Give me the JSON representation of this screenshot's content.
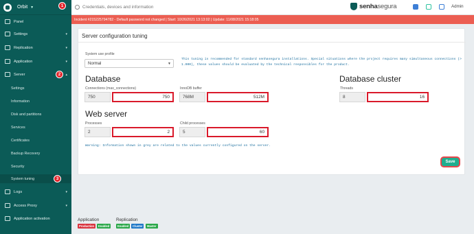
{
  "sidebar": {
    "brand": "Orbit",
    "items": {
      "panel": "Panel",
      "settings": "Settings",
      "replication": "Replication",
      "application": "Application",
      "server": "Server",
      "logs": "Logs",
      "access_proxy": "Access Proxy",
      "app_activation": "Application activation"
    },
    "server_sub": [
      "Settings",
      "Information",
      "Disk and partitions",
      "Services",
      "Certificates",
      "Backup Recovery",
      "Security",
      "System tuning"
    ],
    "steps": [
      "1",
      "2",
      "3"
    ]
  },
  "topbar": {
    "search_placeholder": "Credentials, devices and information",
    "brand_bold": "senha",
    "brand_light": "segura",
    "admin": "Admin"
  },
  "incident": "Incident #215225794782 - Default password not changed | Start: 10/26/2021 13:13:02 | Update: 11/08/2021 15:18:05",
  "card": {
    "title": "Server configuration tuning",
    "profile_label": "System use profile",
    "profile_value": "Normal",
    "note_line1": "This tuning is recommended for standard senhasegura installations. Special situations where the project requires many simultaneous connections (>",
    "note_line2": "1.000), these values should be evaluated by the technical responsibles for the product.",
    "database": {
      "title": "Database",
      "connections_label": "Connections (max_connections)",
      "connections_current": "750",
      "connections_value": "750",
      "buffer_label": "InnoDB buffer",
      "buffer_current": "768M",
      "buffer_value": "512M"
    },
    "cluster": {
      "title": "Database cluster",
      "threads_label": "Threads",
      "threads_current": "8",
      "threads_value": "16"
    },
    "web": {
      "title": "Web server",
      "processes_label": "Processes",
      "processes_current": "2",
      "processes_value": "2",
      "child_label": "Child processes",
      "child_current": "5",
      "child_value": "60"
    },
    "warning": "Warning: Information shown in grey are related to the values currently configured on the server.",
    "save": "Save"
  },
  "footer": {
    "application": {
      "title": "Application",
      "tags": [
        "Production",
        "Enabled"
      ]
    },
    "replication": {
      "title": "Replication",
      "tags": [
        "Enabled",
        "Cluster",
        "Master"
      ]
    }
  },
  "colors": {
    "sidebar": "#0b5b57",
    "incident": "#ec5e52",
    "highlight": "#d9192a",
    "save": "#1fae8f"
  }
}
